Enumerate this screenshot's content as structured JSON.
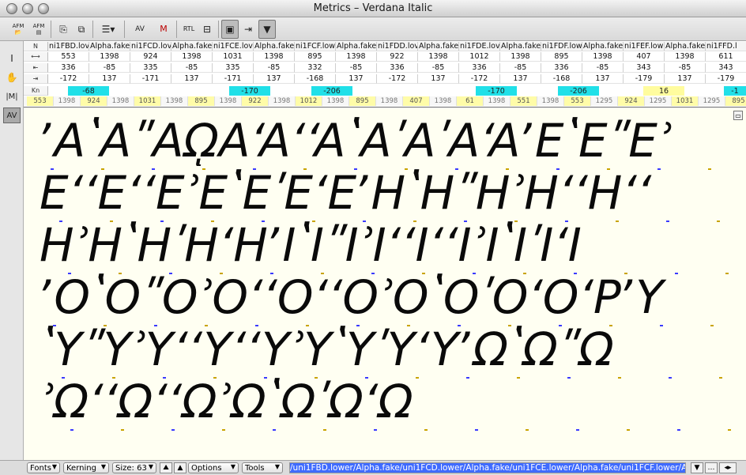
{
  "window": {
    "title": "Metrics – Verdana Italic"
  },
  "icons": [
    "open-afm-icon",
    "save-afm-icon",
    "insert-glyph-icon",
    "open-file-icon",
    "outline-view-icon",
    "kern-av-icon",
    "metrics-m-icon",
    "rtl-icon",
    "link-icon",
    "window-toggle-icon",
    "pane-icon",
    "show-dropdown-icon"
  ],
  "toolbar": {
    "afm1": "AFM",
    "afm2": "AFM",
    "av": "AV",
    "m": "M",
    "rtl": "RTL"
  },
  "tools": [
    "I",
    "✋",
    "|M|",
    "AV"
  ],
  "metrics": {
    "row_header_n": "N",
    "row_header_k": "Kn",
    "headers": [
      "ni1FBD.lov",
      "Alpha.fake",
      "ni1FCD.lov",
      "Alpha.fake",
      "ni1FCE.lov",
      "Alpha.fake",
      "ni1FCF.low",
      "Alpha.fake",
      "ni1FDD.lov",
      "Alpha.fake",
      "ni1FDE.lov",
      "Alpha.fake",
      "ni1FDF.low",
      "Alpha.fake",
      "ni1FEF.low",
      "Alpha.fake",
      "ni1FFD.l"
    ],
    "advance": [
      "553",
      "1398",
      "924",
      "1398",
      "1031",
      "1398",
      "895",
      "1398",
      "922",
      "1398",
      "1012",
      "1398",
      "895",
      "1398",
      "407",
      "1398",
      "611"
    ],
    "lsb": [
      "336",
      "-85",
      "335",
      "-85",
      "335",
      "-85",
      "332",
      "-85",
      "336",
      "-85",
      "336",
      "-85",
      "336",
      "-85",
      "343",
      "-85",
      "343"
    ],
    "rsb": [
      "-172",
      "137",
      "-171",
      "137",
      "-171",
      "137",
      "-168",
      "137",
      "-172",
      "137",
      "-172",
      "137",
      "-168",
      "137",
      "-179",
      "137",
      "-179"
    ],
    "kerns": [
      {
        "value": "-68",
        "style": "cyan"
      },
      {
        "value": "-170",
        "style": "cyan"
      },
      {
        "value": "-206",
        "style": "cyan"
      },
      {
        "value": "-170",
        "style": "cyan"
      },
      {
        "value": "-206",
        "style": "cyan"
      },
      {
        "value": "16",
        "style": "yellow"
      },
      {
        "value": "-1",
        "style": "cyan"
      }
    ],
    "adv_strip": [
      "553",
      "1398",
      "924",
      "1398",
      "1031",
      "1398",
      "895",
      "1398",
      "922",
      "1398",
      "1012",
      "1398",
      "895",
      "1398",
      "407",
      "1398",
      "61",
      "1398",
      "551",
      "1398",
      "553",
      "1295",
      "924",
      "1295",
      "1031",
      "1295",
      "895"
    ]
  },
  "canvas": {
    "lines": [
      "ʼAʽAʺAῼAʻAʻʻAʽAʹAʹAʻAʼEʽEʺEʾ",
      "EʻʻEʻʻEʾEʽEʹEʻEʼHʽHʺHʾHʻʻHʻʻ",
      "HʾHʽHʹHʻHʼIʽIʺIʾIʻʻIʻʻIʾIʽIʹIʻI",
      "ʼOʽOʺOʾOʻʻOʻʻOʾOʽOʹOʻOʻPʼY",
      "ʽYʺYʾYʻʻYʻʻYʾYʽYʹYʻYʼΩʽΩʺΩ",
      "ʾΩʻʻΩʻʻΩʾΩʽΩʹΩʻΩ"
    ]
  },
  "bottom": {
    "fonts": "Fonts",
    "kerning": "Kerning",
    "size": "Size: 63",
    "options": "Options",
    "tools": "Tools",
    "text": "/uni1FBD.lower/Alpha.fake/uni1FCD.lower/Alpha.fake/uni1FCE.lower/Alpha.fake/uni1FCF.lower/Alpha"
  }
}
